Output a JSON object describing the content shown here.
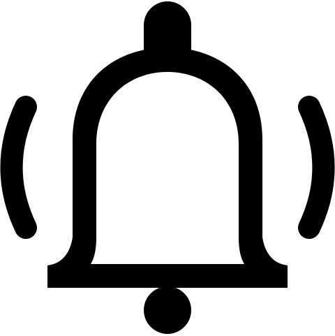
{
  "icon": {
    "name": "bell-ringing-icon",
    "color": "#000000",
    "background": "#ffffff"
  }
}
